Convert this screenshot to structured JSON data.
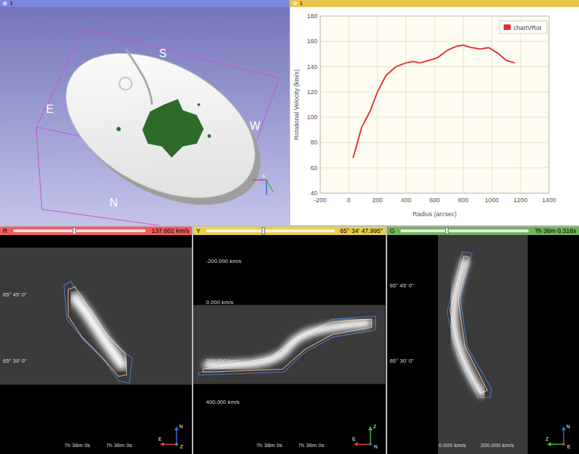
{
  "views": {
    "three_d": {
      "header": "1",
      "orientation_labels": {
        "top": "S",
        "left": "E",
        "right": "W",
        "bottom": "N"
      },
      "axis_label": "E"
    },
    "chart": {
      "header": "1",
      "y_title": "Rotational Velocity (km/s)",
      "x_title": "Radius (arcsec)",
      "y_ticks": [
        "40",
        "60",
        "80",
        "100",
        "120",
        "140",
        "160",
        "180"
      ],
      "x_ticks": [
        "-200",
        "0",
        "200",
        "400",
        "600",
        "800",
        "1000",
        "1200",
        "1400"
      ],
      "legend": "chartVRot",
      "series": [
        {
          "name": "chartVRot",
          "color": "#e0302f",
          "x": [
            30,
            90,
            150,
            200,
            260,
            330,
            400,
            450,
            500,
            560,
            620,
            690,
            750,
            800,
            860,
            920,
            980,
            1050,
            1100,
            1160
          ],
          "y": [
            68,
            92,
            105,
            120,
            133,
            140,
            143,
            144,
            143,
            145,
            147,
            153,
            156,
            157,
            155,
            154,
            155,
            150,
            145,
            143
          ]
        }
      ]
    }
  },
  "slices": [
    {
      "name": "R",
      "color": "#ec5f5f",
      "level": 0.45,
      "reading": "137.602 km/s",
      "left_ticks": [
        "65° 45' 0\"",
        "65° 30' 0\""
      ],
      "bottom_ticks": [
        "7h 38m 0s",
        "7h 36m 0s"
      ],
      "axes": [
        "N",
        "E",
        "Z"
      ]
    },
    {
      "name": "Y",
      "color": "#e9cf4f",
      "level": 0.43,
      "reading": "65° 34' 47.995\"",
      "left_ticks": [
        "-200.000 km/s",
        "0.000 km/s",
        "200.000 km/s",
        "400.000 km/s"
      ],
      "bottom_ticks": [
        "7h 38m 0s",
        "7h 36m 0s"
      ],
      "axes": [
        "Z",
        "E",
        "N"
      ]
    },
    {
      "name": "G",
      "color": "#72b45e",
      "level": 0.35,
      "reading": "7h 36m 0.318s",
      "left_ticks": [
        "65° 45' 0\"",
        "65° 30' 0\""
      ],
      "bottom_ticks": [
        "0.000 km/s",
        "200.000 km/s"
      ],
      "axes": [
        "N",
        "Z",
        "E"
      ]
    }
  ]
}
